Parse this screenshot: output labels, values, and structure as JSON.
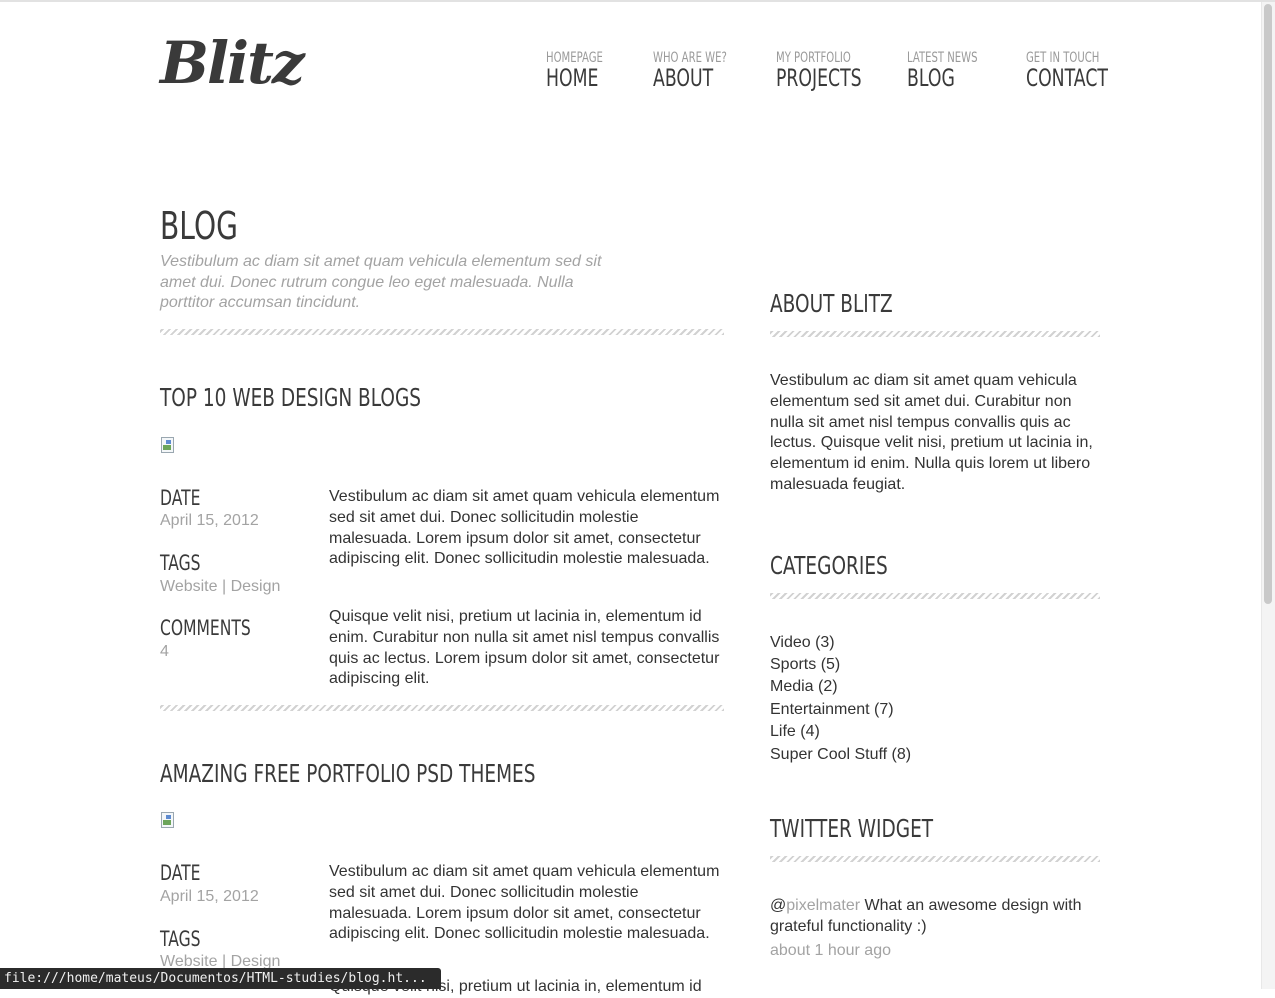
{
  "site": {
    "logo": "Blitz"
  },
  "nav": [
    {
      "sub": "HOMEPAGE",
      "main": "HOME"
    },
    {
      "sub": "WHO ARE WE?",
      "main": "ABOUT"
    },
    {
      "sub": "MY PORTFOLIO",
      "main": "PROJECTS"
    },
    {
      "sub": "LATEST NEWS",
      "main": "BLOG"
    },
    {
      "sub": "GET IN TOUCH",
      "main": "CONTACT"
    }
  ],
  "page": {
    "title": "BLOG",
    "intro": "Vestibulum ac diam sit amet quam vehicula elementum sed sit amet dui. Donec rutrum congue leo eget malesuada. Nulla porttitor accumsan tincidunt."
  },
  "posts": [
    {
      "title": "TOP 10 WEB DESIGN BLOGS",
      "date_label": "DATE",
      "date": "April 15, 2012",
      "tags_label": "TAGS",
      "tag1": "Website",
      "tag_sep": " | ",
      "tag2": "Design",
      "comments_label": "COMMENTS",
      "comments": "4",
      "p1": "Vestibulum ac diam sit amet quam vehicula elementum sed sit amet dui. Donec sollicitudin molestie malesuada. Lorem ipsum dolor sit amet, consectetur adipiscing elit. Donec sollicitudin molestie malesuada.",
      "p2": "Quisque velit nisi, pretium ut lacinia in, elementum id enim. Curabitur non nulla sit amet nisl tempus convallis quis ac lectus. Lorem ipsum dolor sit amet, consectetur adipiscing elit."
    },
    {
      "title": "AMAZING FREE PORTFOLIO PSD THEMES",
      "date_label": "DATE",
      "date": "April 15, 2012",
      "tags_label": "TAGS",
      "tag1": "Website",
      "tag_sep": " | ",
      "tag2": "Design",
      "p1": "Vestibulum ac diam sit amet quam vehicula elementum sed sit amet dui. Donec sollicitudin molestie malesuada. Lorem ipsum dolor sit amet, consectetur adipiscing elit. Donec sollicitudin molestie malesuada.",
      "p2_partial": "Quisque velit nisi, pretium ut lacinia in, elementum id"
    }
  ],
  "sidebar": {
    "about_title": "ABOUT BLITZ",
    "about_text": "Vestibulum ac diam sit amet quam vehicula elementum sed sit amet dui. Curabitur non nulla sit amet nisl tempus convallis quis ac lectus. Quisque velit nisi, pretium ut lacinia in, elementum id enim. Nulla quis lorem ut libero malesuada feugiat.",
    "categories_title": "CATEGORIES",
    "categories": [
      "Video (3)",
      "Sports (5)",
      "Media (2)",
      "Entertainment (7)",
      "Life (4)",
      "Super Cool Stuff (8)"
    ],
    "twitter_title": "TWITTER WIDGET",
    "tweet_at": "@",
    "tweet_handle": "pixelmater",
    "tweet_text": " What an awesome design with grateful functionality :)",
    "tweet_time": "about 1 hour ago"
  },
  "statusbar": {
    "url": "file:///home/mateus/Documentos/HTML-studies/blog.ht..."
  },
  "colors": {
    "text": "#333333",
    "muted": "#a3a3a3",
    "heading": "#3a3a3a",
    "hatch": "#d2d2d2"
  }
}
